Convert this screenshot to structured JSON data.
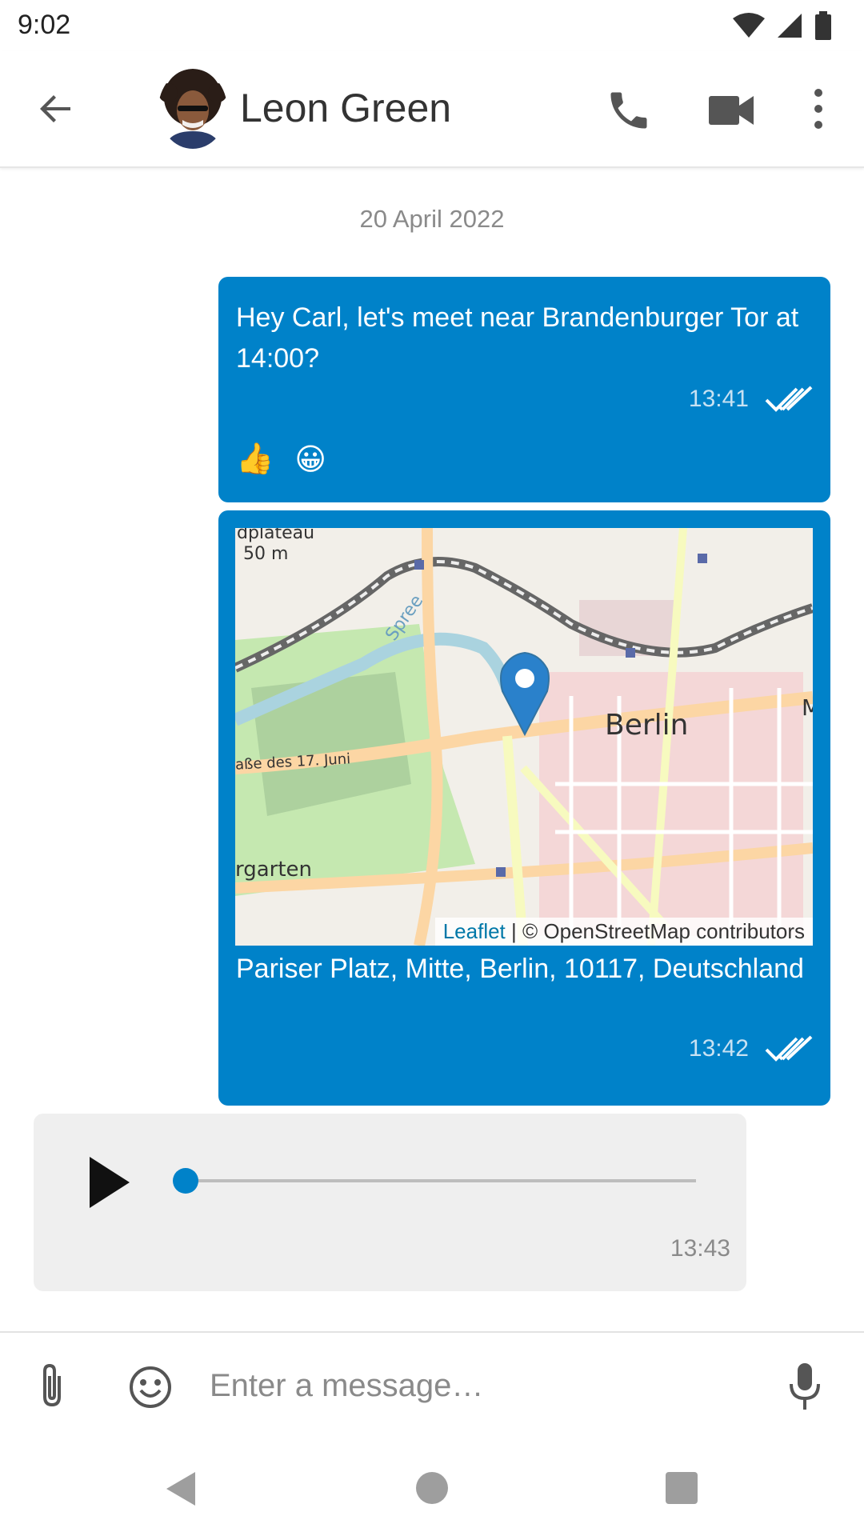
{
  "status_bar": {
    "time": "9:02"
  },
  "header": {
    "contact_name": "Leon Green"
  },
  "conversation": {
    "date_label": "20 April 2022",
    "messages": [
      {
        "text": "Hey Carl, let's meet near Brandenburger Tor at 14:00?",
        "time": "13:41",
        "status": "read",
        "reactions": [
          "👍",
          "😀"
        ]
      },
      {
        "map": {
          "labels": {
            "city": "Berlin",
            "river": "Spree",
            "street": "aße des 17. Juni",
            "park": "rgarten",
            "plateau": "dplateau",
            "elevation": "50 m",
            "edge": "M"
          },
          "attribution_link": "Leaflet",
          "attribution_text": " | © OpenStreetMap contributors"
        },
        "address": "Pariser Platz, Mitte, Berlin, 10117, Deutschland",
        "time": "13:42",
        "status": "read"
      },
      {
        "type": "voice",
        "progress": 0,
        "time": "13:43"
      }
    ]
  },
  "composer": {
    "placeholder": "Enter a message…"
  },
  "colors": {
    "accent": "#0082c9",
    "incoming_bubble": "#efefef",
    "meta_text": "#8a8a8a"
  },
  "icons": [
    "back-arrow-icon",
    "phone-icon",
    "video-camera-icon",
    "more-vert-icon",
    "double-check-icon",
    "map-pin-icon",
    "play-icon",
    "paperclip-icon",
    "emoji-icon",
    "microphone-icon",
    "nav-back-icon",
    "nav-home-icon",
    "nav-recents-icon",
    "wifi-icon",
    "signal-icon",
    "battery-icon"
  ]
}
